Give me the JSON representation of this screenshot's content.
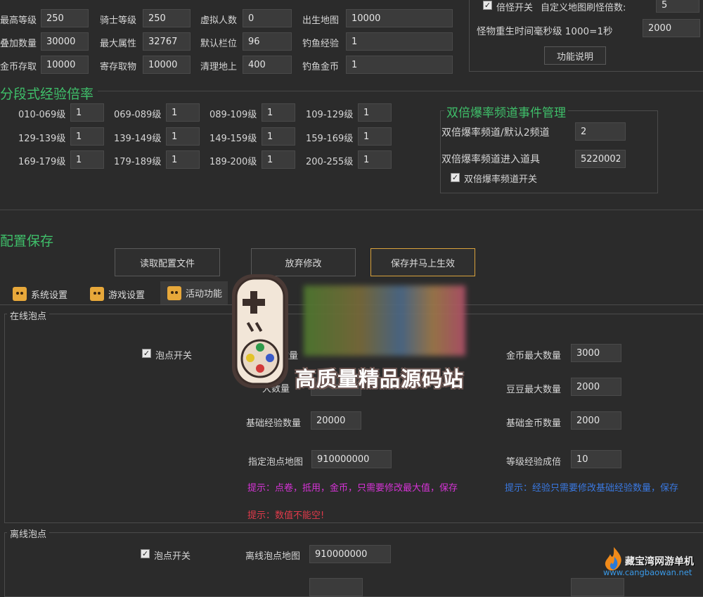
{
  "top": {
    "rows": [
      [
        {
          "label": "最高等级",
          "value": "250"
        },
        {
          "label": "骑士等级",
          "value": "250"
        },
        {
          "label": "虚拟人数",
          "value": "0"
        },
        {
          "label": "出生地图",
          "value": "10000"
        }
      ],
      [
        {
          "label": "叠加数量",
          "value": "30000"
        },
        {
          "label": "最大属性",
          "value": "32767"
        },
        {
          "label": "默认栏位",
          "value": "96"
        },
        {
          "label": "钓鱼经验",
          "value": "1"
        }
      ],
      [
        {
          "label": "金币存取",
          "value": "10000"
        },
        {
          "label": "寄存取物",
          "value": "10000"
        },
        {
          "label": "清理地上",
          "value": "400"
        },
        {
          "label": "钓鱼金币",
          "value": "1"
        }
      ]
    ],
    "double_switch_label": "倍怪开关",
    "custom_map_label": "自定义地图刷怪倍数:",
    "custom_map_value": "5",
    "respawn_label": "怪物重生时间毫秒级 1000=1秒",
    "respawn_value": "2000",
    "feature_button": "功能说明"
  },
  "exp_section": {
    "title": "分段式经验倍率",
    "rows": [
      [
        {
          "label": "010-069级",
          "value": "1"
        },
        {
          "label": "069-089级",
          "value": "1"
        },
        {
          "label": "089-109级",
          "value": "1"
        },
        {
          "label": "109-129级",
          "value": "1"
        }
      ],
      [
        {
          "label": "129-139级",
          "value": "1"
        },
        {
          "label": "139-149级",
          "value": "1"
        },
        {
          "label": "149-159级",
          "value": "1"
        },
        {
          "label": "159-169级",
          "value": "1"
        }
      ],
      [
        {
          "label": "169-179级",
          "value": "1"
        },
        {
          "label": "179-189级",
          "value": "1"
        },
        {
          "label": "189-200级",
          "value": "1"
        },
        {
          "label": "200-255级",
          "value": "1"
        }
      ]
    ]
  },
  "double_drop": {
    "title": "双倍爆率频道事件管理",
    "channel_label": "双倍爆率频道/默认2频道",
    "channel_value": "2",
    "item_label": "双倍爆率频道进入道具",
    "item_value": "5220002",
    "switch_label": "双倍爆率频道开关"
  },
  "config_save": {
    "title": "配置保存",
    "read_button": "读取配置文件",
    "discard_button": "放弃修改",
    "save_button": "保存并马上生效"
  },
  "tabs": [
    {
      "label": "系统设置"
    },
    {
      "label": "游戏设置"
    },
    {
      "label": "活动功能"
    }
  ],
  "overlay": {
    "watermark_text": "高质量精品源码站",
    "corner_brand": "藏宝湾网游单机",
    "corner_url": "www.cangbaowan.net"
  },
  "online": {
    "legend": "在线泡点",
    "switch_label": "泡点开关",
    "gold_max_label": "金币最大数量",
    "gold_max_value": "3000",
    "bean_max_label": "豆豆最大数量",
    "bean_max_value": "2000",
    "base_exp_label": "基础经验数量",
    "base_exp_value": "20000",
    "base_gold_label": "基础金币数量",
    "base_gold_value": "2000",
    "map_label": "指定泡点地图",
    "map_value": "910000000",
    "level_mult_label": "等级经验成倍",
    "level_mult_value": "10",
    "partial_label": "大数量",
    "hint1": "提示：点卷，抵用，金币，只需要修改最大值，保存",
    "hint2": "提示：经验只需要修改基础经验数量，保存",
    "hint3": "提示：数值不能空!"
  },
  "offline": {
    "legend": "离线泡点",
    "switch_label": "泡点开关",
    "map_label": "离线泡点地图",
    "map_value": "910000000"
  }
}
